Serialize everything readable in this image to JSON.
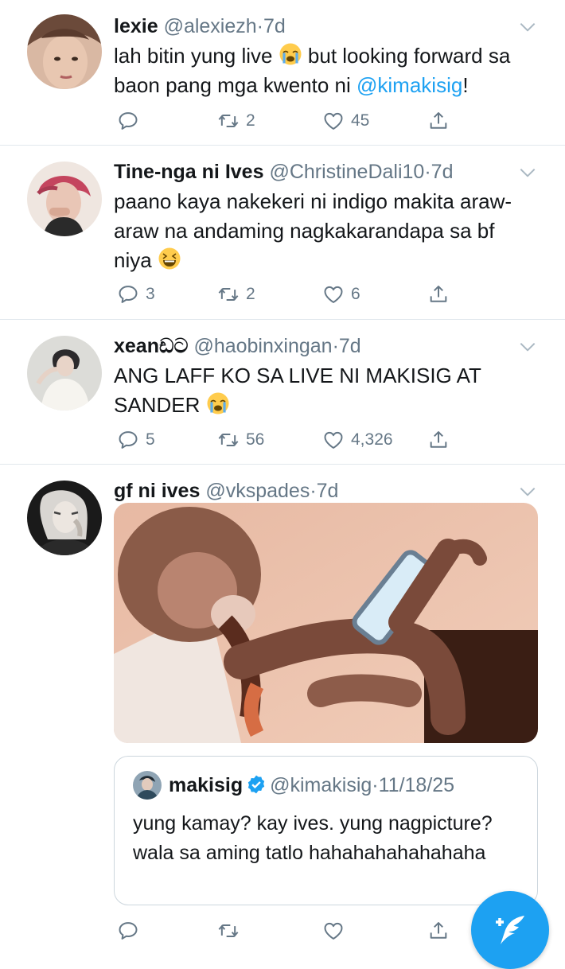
{
  "tweets": [
    {
      "name": "lexie",
      "handle": "@alexiezh",
      "sep": "·",
      "time": "7d",
      "text_a": "lah bitin yung live ",
      "text_b": " but looking forward sa baon pang mga kwento ni ",
      "mention": "@kimakisig",
      "text_c": "!",
      "emoji": "crying-face-emoji",
      "replies": "",
      "retweets": "2",
      "likes": "45"
    },
    {
      "name": "Tine-nga ni Ives",
      "handle": "@ChristineDali10",
      "sep": "·",
      "time": "7d",
      "text_a": "paano kaya nakekeri ni indigo makita araw-araw na andaming nagkakarandapa sa bf niya ",
      "emoji": "grinning-squinting-face-emoji",
      "replies": "3",
      "retweets": "2",
      "likes": "6"
    },
    {
      "name": "xeanඩට",
      "handle": "@haobinxingan",
      "sep": "·",
      "time": "7d",
      "text_a": "ANG LAFF KO SA LIVE NI MAKISIG AT SANDER ",
      "emoji": "crying-face-emoji",
      "replies": "5",
      "retweets": "56",
      "likes": "4,326"
    },
    {
      "name": "gf ni ives",
      "handle": "@vkspades",
      "sep": "·",
      "time": "7d",
      "media": "monkey-using-phone-gif",
      "replies": "",
      "retweets": "",
      "likes": ""
    }
  ],
  "quote": {
    "name": "makisig",
    "handle": "@kimakisig",
    "sep": "·",
    "date": "11/18/25",
    "text": "yung kamay? kay ives. yung nagpicture? wala sa aming tatlo hahahahahahahaha"
  },
  "colors": {
    "accent": "#1da1f2",
    "muted": "#657786",
    "divider": "#e1e8ed"
  },
  "icons": [
    "reply-icon",
    "retweet-icon",
    "like-icon",
    "share-icon",
    "chevron-down-icon",
    "verified-icon",
    "compose-tweet-icon"
  ]
}
